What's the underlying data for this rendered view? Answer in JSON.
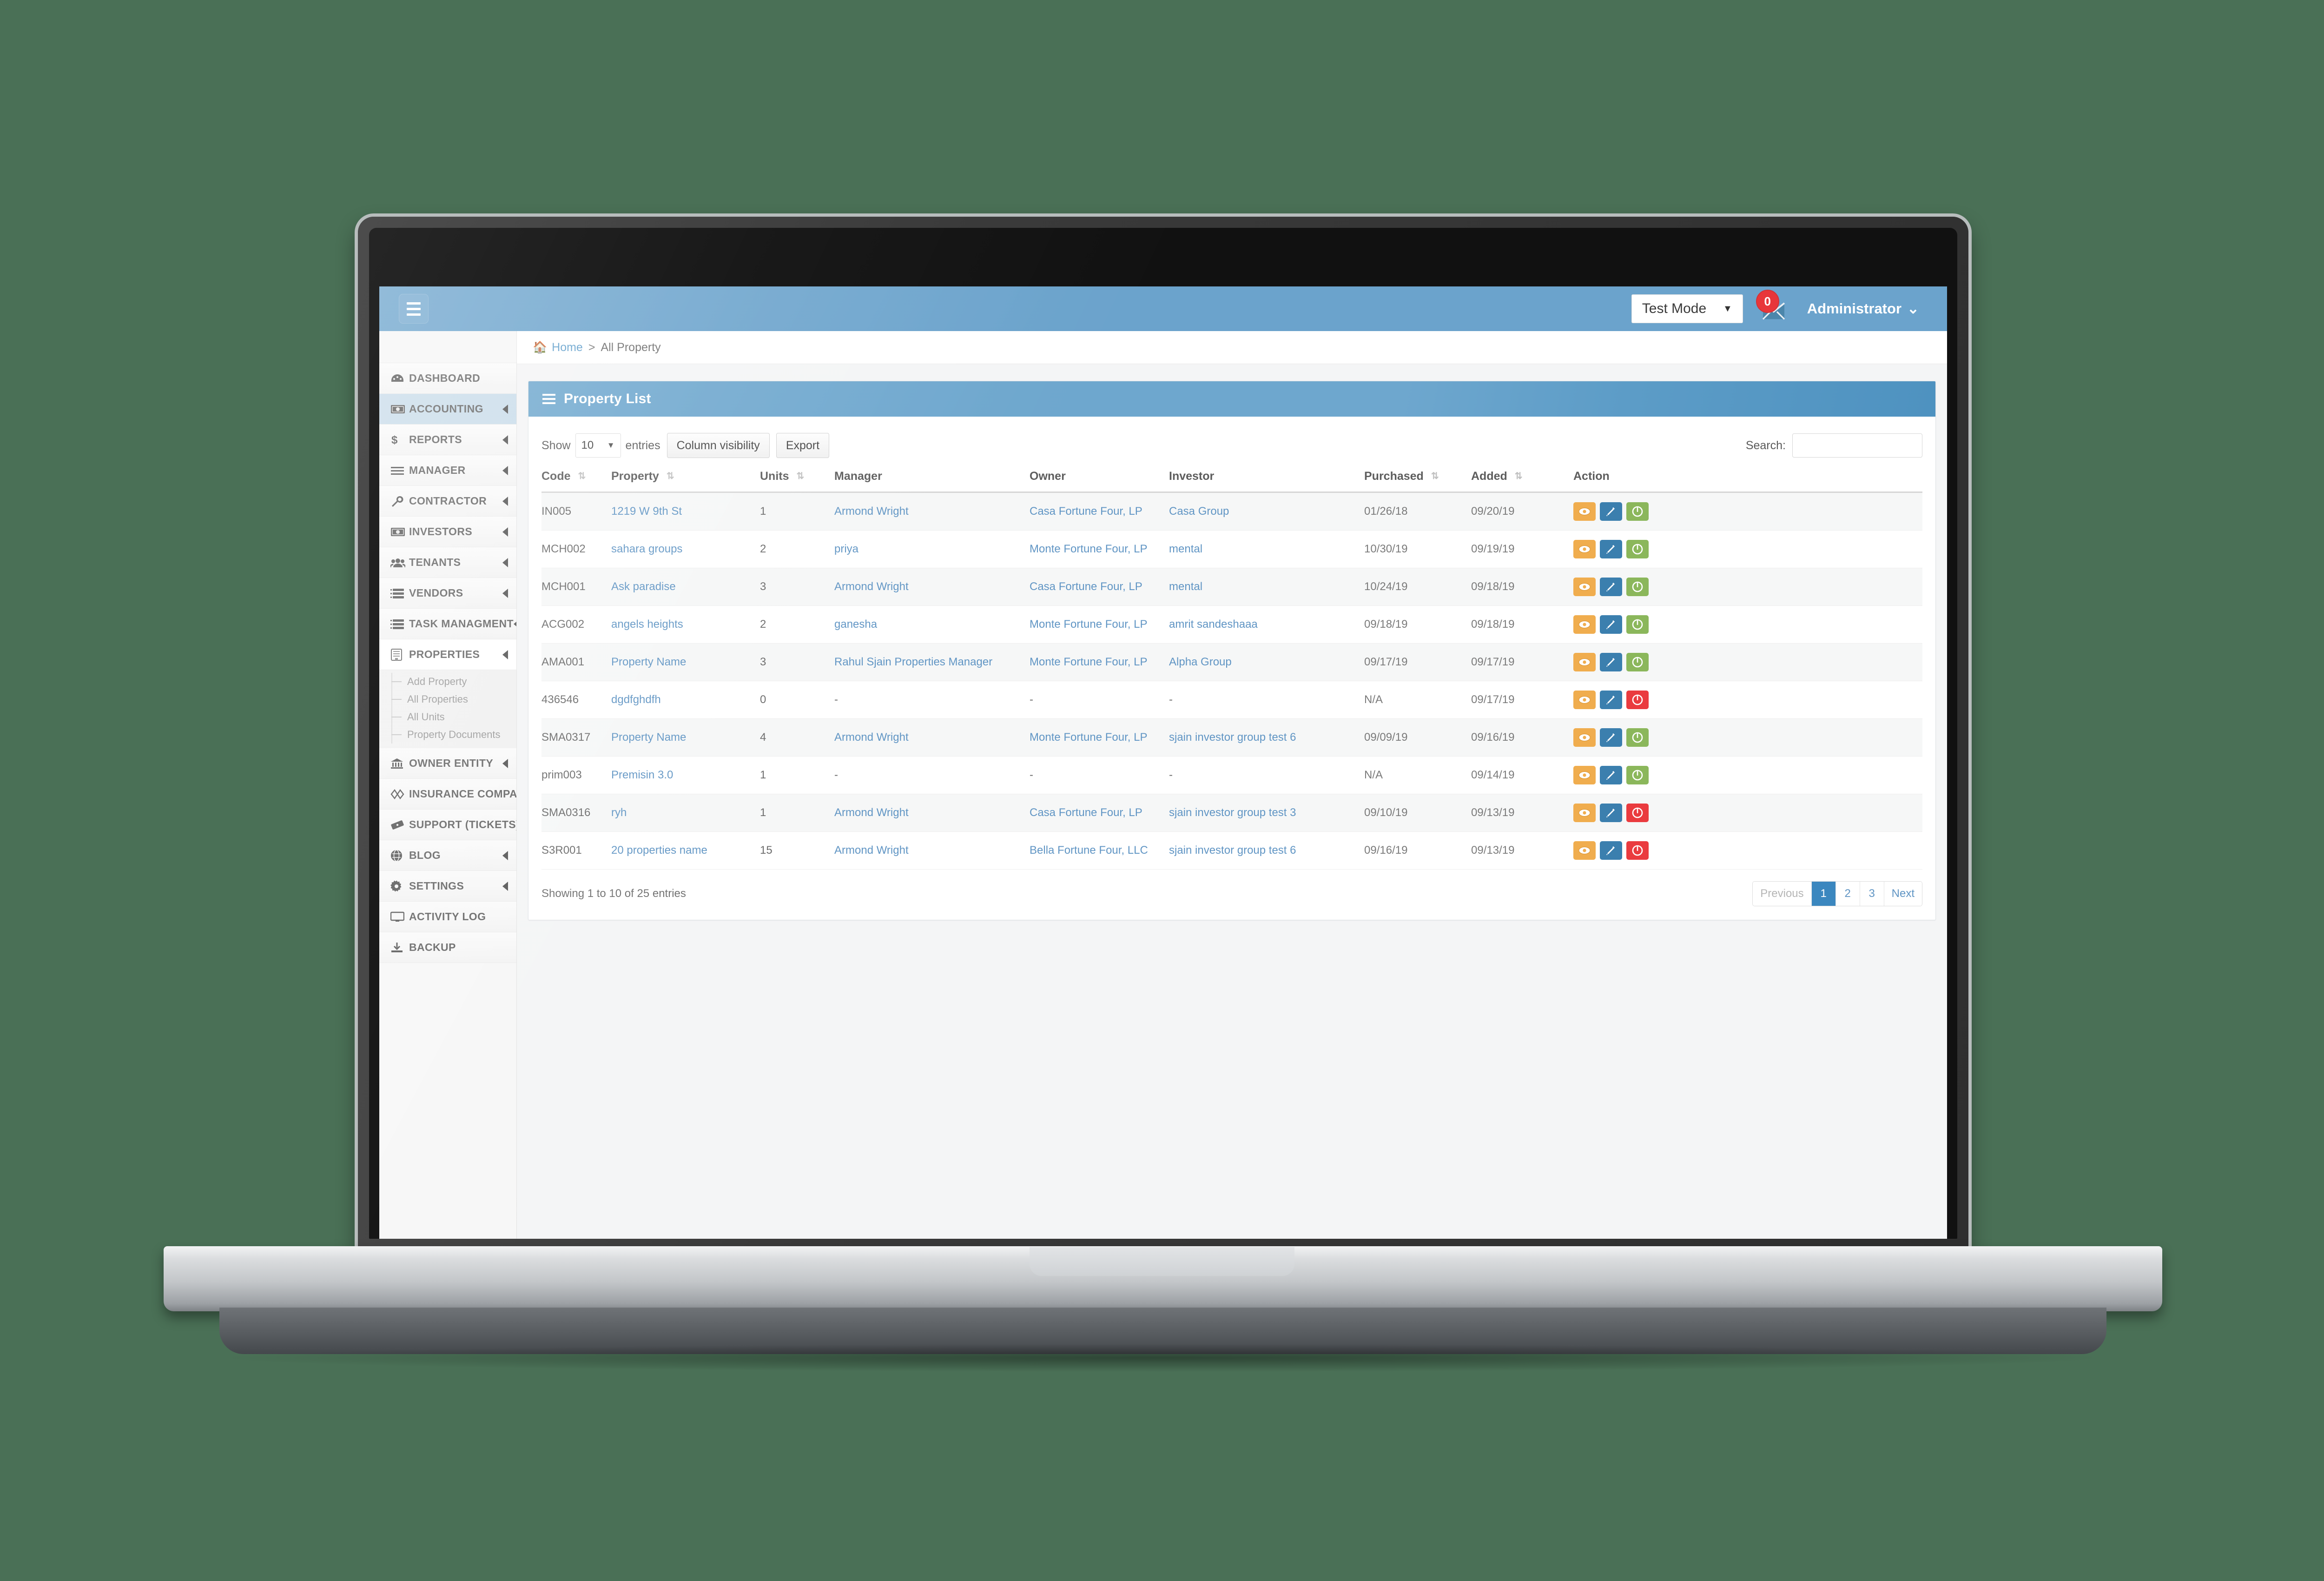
{
  "topbar": {
    "menu_toggle": "menu-toggle",
    "test_mode_label": "Test Mode",
    "mail_badge": "0",
    "admin_label": "Administrator"
  },
  "sidebar": {
    "items": [
      {
        "label": "DASHBOARD",
        "icon": "dashboard-icon",
        "arrow": false,
        "state": "normal"
      },
      {
        "label": "ACCOUNTING",
        "icon": "money-icon",
        "arrow": true,
        "state": "active"
      },
      {
        "label": "REPORTS",
        "icon": "dollar-icon",
        "arrow": true,
        "state": "normal"
      },
      {
        "label": "MANAGER",
        "icon": "list-icon",
        "arrow": true,
        "state": "normal"
      },
      {
        "label": "CONTRACTOR",
        "icon": "wrench-icon",
        "arrow": true,
        "state": "normal"
      },
      {
        "label": "INVESTORS",
        "icon": "money-icon",
        "arrow": true,
        "state": "normal"
      },
      {
        "label": "TENANTS",
        "icon": "users-icon",
        "arrow": true,
        "state": "normal"
      },
      {
        "label": "VENDORS",
        "icon": "server-icon",
        "arrow": true,
        "state": "normal"
      },
      {
        "label": "TASK MANAGMENT",
        "icon": "server-icon",
        "arrow": true,
        "state": "normal"
      },
      {
        "label": "PROPERTIES",
        "icon": "building-icon",
        "arrow": true,
        "state": "open"
      },
      {
        "label": "OWNER ENTITY",
        "icon": "bank-icon",
        "arrow": true,
        "state": "normal"
      },
      {
        "label": "INSURANCE COMPANY",
        "icon": "shield-icon",
        "arrow": true,
        "state": "normal"
      },
      {
        "label": "SUPPORT (TICKETS)",
        "icon": "ticket-icon",
        "arrow": true,
        "state": "normal"
      },
      {
        "label": "BLOG",
        "icon": "globe-icon",
        "arrow": true,
        "state": "normal"
      },
      {
        "label": "SETTINGS",
        "icon": "gear-icon",
        "arrow": true,
        "state": "normal"
      },
      {
        "label": "ACTIVITY LOG",
        "icon": "monitor-icon",
        "arrow": false,
        "state": "normal"
      },
      {
        "label": "BACKUP",
        "icon": "download-icon",
        "arrow": false,
        "state": "normal"
      }
    ],
    "properties_submenu": [
      "Add Property",
      "All Properties",
      "All Units",
      "Property Documents"
    ]
  },
  "breadcrumb": {
    "home": "Home",
    "separator": ">",
    "current": "All Property"
  },
  "panel": {
    "title": "Property List"
  },
  "controls": {
    "show_label": "Show",
    "page_length": "10",
    "entries_label": "entries",
    "column_visibility": "Column visibility",
    "export": "Export",
    "search_label": "Search:",
    "search_value": "",
    "search_placeholder": ""
  },
  "table": {
    "columns": [
      {
        "label": "Code",
        "sortable": true
      },
      {
        "label": "Property",
        "sortable": true
      },
      {
        "label": "Units",
        "sortable": true
      },
      {
        "label": "Manager",
        "sortable": false
      },
      {
        "label": "Owner",
        "sortable": false
      },
      {
        "label": "Investor",
        "sortable": false
      },
      {
        "label": "Purchased",
        "sortable": true
      },
      {
        "label": "Added",
        "sortable": true
      },
      {
        "label": "Action",
        "sortable": false
      }
    ],
    "rows": [
      {
        "code": "IN005",
        "property": "1219 W 9th St",
        "units": "1",
        "manager": "Armond Wright",
        "owner": "Casa Fortune Four, LP",
        "investor": "Casa Group",
        "purchased": "01/26/18",
        "added": "09/20/19",
        "status": "on"
      },
      {
        "code": "MCH002",
        "property": "sahara groups",
        "units": "2",
        "manager": "priya",
        "owner": "Monte Fortune Four, LP",
        "investor": "mental",
        "purchased": "10/30/19",
        "added": "09/19/19",
        "status": "on"
      },
      {
        "code": "MCH001",
        "property": "Ask paradise",
        "units": "3",
        "manager": "Armond Wright",
        "owner": "Casa Fortune Four, LP",
        "investor": "mental",
        "purchased": "10/24/19",
        "added": "09/18/19",
        "status": "on"
      },
      {
        "code": "ACG002",
        "property": "angels heights",
        "units": "2",
        "manager": "ganesha",
        "owner": "Monte Fortune Four, LP",
        "investor": "amrit sandeshaaa",
        "purchased": "09/18/19",
        "added": "09/18/19",
        "status": "on"
      },
      {
        "code": "AMA001",
        "property": "Property Name",
        "units": "3",
        "manager": "Rahul Sjain Properties Manager",
        "owner": "Monte Fortune Four, LP",
        "investor": "Alpha Group",
        "purchased": "09/17/19",
        "added": "09/17/19",
        "status": "on"
      },
      {
        "code": "436546",
        "property": "dgdfghdfh",
        "units": "0",
        "manager": "-",
        "owner": "-",
        "investor": "-",
        "purchased": "N/A",
        "added": "09/17/19",
        "status": "off"
      },
      {
        "code": "SMA0317",
        "property": "Property Name",
        "units": "4",
        "manager": "Armond Wright",
        "owner": "Monte Fortune Four, LP",
        "investor": "sjain investor group test 6",
        "purchased": "09/09/19",
        "added": "09/16/19",
        "status": "on"
      },
      {
        "code": "prim003",
        "property": "Premisin 3.0",
        "units": "1",
        "manager": "-",
        "owner": "-",
        "investor": "-",
        "purchased": "N/A",
        "added": "09/14/19",
        "status": "on"
      },
      {
        "code": "SMA0316",
        "property": "ryh",
        "units": "1",
        "manager": "Armond Wright",
        "owner": "Casa Fortune Four, LP",
        "investor": "sjain investor group test 3",
        "purchased": "09/10/19",
        "added": "09/13/19",
        "status": "off"
      },
      {
        "code": "S3R001",
        "property": "20 properties name",
        "units": "15",
        "manager": "Armond Wright",
        "owner": "Bella Fortune Four, LLC",
        "investor": "sjain investor group test 6",
        "purchased": "09/16/19",
        "added": "09/13/19",
        "status": "off"
      }
    ],
    "action_icons": {
      "view": "eye-icon",
      "edit": "pencil-icon",
      "toggle": "power-icon"
    }
  },
  "footer": {
    "showing": "Showing 1 to 10 of 25 entries",
    "pagination": [
      {
        "label": "Previous",
        "state": "disabled"
      },
      {
        "label": "1",
        "state": "active"
      },
      {
        "label": "2",
        "state": "normal"
      },
      {
        "label": "3",
        "state": "normal"
      },
      {
        "label": "Next",
        "state": "normal"
      }
    ]
  },
  "colors": {
    "brand_blue": "#6ba3cc",
    "accent_blue": "#3b87bf",
    "link_blue": "#6095c4",
    "view_orange": "#f0ad4e",
    "edit_blue": "#3b7fae",
    "status_on_green": "#8bb75b",
    "status_off_red": "#ea3b3f",
    "badge_red": "#e8363a",
    "page_bg": "#4a7056"
  }
}
